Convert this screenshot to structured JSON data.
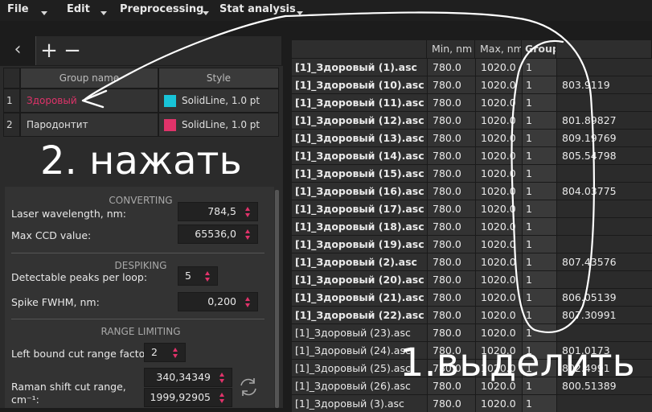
{
  "menu": {
    "items": [
      {
        "label": "File"
      },
      {
        "label": "Edit"
      },
      {
        "label": "Preprocessing"
      },
      {
        "label": "Stat analysis"
      }
    ]
  },
  "toolbar": {
    "back_icon": "chevron-left-icon",
    "add_icon": "plus-icon",
    "remove_icon": "minus-icon"
  },
  "groups_table": {
    "headers": [
      "Group name",
      "Style"
    ],
    "rows": [
      {
        "num": "1",
        "name": "Здоровый",
        "style": "SolidLine, 1.0 pt",
        "color": "#18c4d8",
        "name_color": "#e0336a"
      },
      {
        "num": "2",
        "name": "Пародонтит",
        "style": "SolidLine, 1.0 pt",
        "color": "#e0336a",
        "name_color": "#e6e6e6"
      }
    ]
  },
  "settings": {
    "converting": {
      "title": "CONVERTING",
      "laser_label": "Laser wavelength, nm:",
      "laser_value": "784,5",
      "ccd_label": "Max CCD value:",
      "ccd_value": "65536,0"
    },
    "despiking": {
      "title": "DESPIKING",
      "peaks_label": "Detectable peaks per loop:",
      "peaks_value": "5",
      "fwhm_label": "Spike FWHM, nm:",
      "fwhm_value": "0,200"
    },
    "range_limiting": {
      "title": "RANGE LIMITING",
      "left_bound_label": "Left bound cut range factor:",
      "left_bound_value": "2",
      "raman_label_line1": "Raman shift cut range,",
      "raman_label_line2": "cm⁻¹:",
      "raman_min": "340,34349",
      "raman_max": "1999,92905"
    }
  },
  "files_table": {
    "headers": [
      "",
      "Min, nm",
      "Max, nm",
      "Group",
      ""
    ],
    "rows": [
      {
        "name": "[1]_Здоровый (1).asc",
        "min": "780.0",
        "max": "1020.0",
        "group": "1",
        "extra": "",
        "bold": true
      },
      {
        "name": "[1]_Здоровый (10).asc",
        "min": "780.0",
        "max": "1020.0",
        "group": "1",
        "extra": "803.9119",
        "bold": true
      },
      {
        "name": "[1]_Здоровый (11).asc",
        "min": "780.0",
        "max": "1020.0",
        "group": "1",
        "extra": "",
        "bold": true
      },
      {
        "name": "[1]_Здоровый (12).asc",
        "min": "780.0",
        "max": "1020.0",
        "group": "1",
        "extra": "801.89827",
        "bold": true
      },
      {
        "name": "[1]_Здоровый (13).asc",
        "min": "780.0",
        "max": "1020.0",
        "group": "1",
        "extra": "809.19769",
        "bold": true
      },
      {
        "name": "[1]_Здоровый (14).asc",
        "min": "780.0",
        "max": "1020.0",
        "group": "1",
        "extra": "805.54798",
        "bold": true
      },
      {
        "name": "[1]_Здоровый (15).asc",
        "min": "780.0",
        "max": "1020.0",
        "group": "1",
        "extra": "",
        "bold": true
      },
      {
        "name": "[1]_Здоровый (16).asc",
        "min": "780.0",
        "max": "1020.0",
        "group": "1",
        "extra": "804.03775",
        "bold": true
      },
      {
        "name": "[1]_Здоровый (17).asc",
        "min": "780.0",
        "max": "1020.0",
        "group": "1",
        "extra": "",
        "bold": true
      },
      {
        "name": "[1]_Здоровый (18).asc",
        "min": "780.0",
        "max": "1020.0",
        "group": "1",
        "extra": "",
        "bold": true
      },
      {
        "name": "[1]_Здоровый (19).asc",
        "min": "780.0",
        "max": "1020.0",
        "group": "1",
        "extra": "",
        "bold": true
      },
      {
        "name": "[1]_Здоровый (2).asc",
        "min": "780.0",
        "max": "1020.0",
        "group": "1",
        "extra": "807.43576",
        "bold": true
      },
      {
        "name": "[1]_Здоровый (20).asc",
        "min": "780.0",
        "max": "1020.0",
        "group": "1",
        "extra": "",
        "bold": true
      },
      {
        "name": "[1]_Здоровый (21).asc",
        "min": "780.0",
        "max": "1020.0",
        "group": "1",
        "extra": "806.05139",
        "bold": true
      },
      {
        "name": "[1]_Здоровый (22).asc",
        "min": "780.0",
        "max": "1020.0",
        "group": "1",
        "extra": "807.30991",
        "bold": true
      },
      {
        "name": "[1]_Здоровый (23).asc",
        "min": "780.0",
        "max": "1020.0",
        "group": "1",
        "extra": "",
        "bold": false
      },
      {
        "name": "[1]_Здоровый (24).asc",
        "min": "780.0",
        "max": "1020.0",
        "group": "1",
        "extra": "801.0173",
        "bold": false
      },
      {
        "name": "[1]_Здоровый (25).asc",
        "min": "780.0",
        "max": "1020.0",
        "group": "1",
        "extra": "802.4991",
        "bold": false
      },
      {
        "name": "[1]_Здоровый (26).asc",
        "min": "780.0",
        "max": "1020.0",
        "group": "1",
        "extra": "800.51389",
        "bold": false
      },
      {
        "name": "[1]_Здоровый (3).asc",
        "min": "780.0",
        "max": "1020.0",
        "group": "1",
        "extra": "",
        "bold": false
      }
    ]
  },
  "annotations": {
    "step2": "2. нажать",
    "step1": "1.выделить"
  },
  "colors": {
    "accent": "#e0336a",
    "cyan": "#18c4d8"
  }
}
